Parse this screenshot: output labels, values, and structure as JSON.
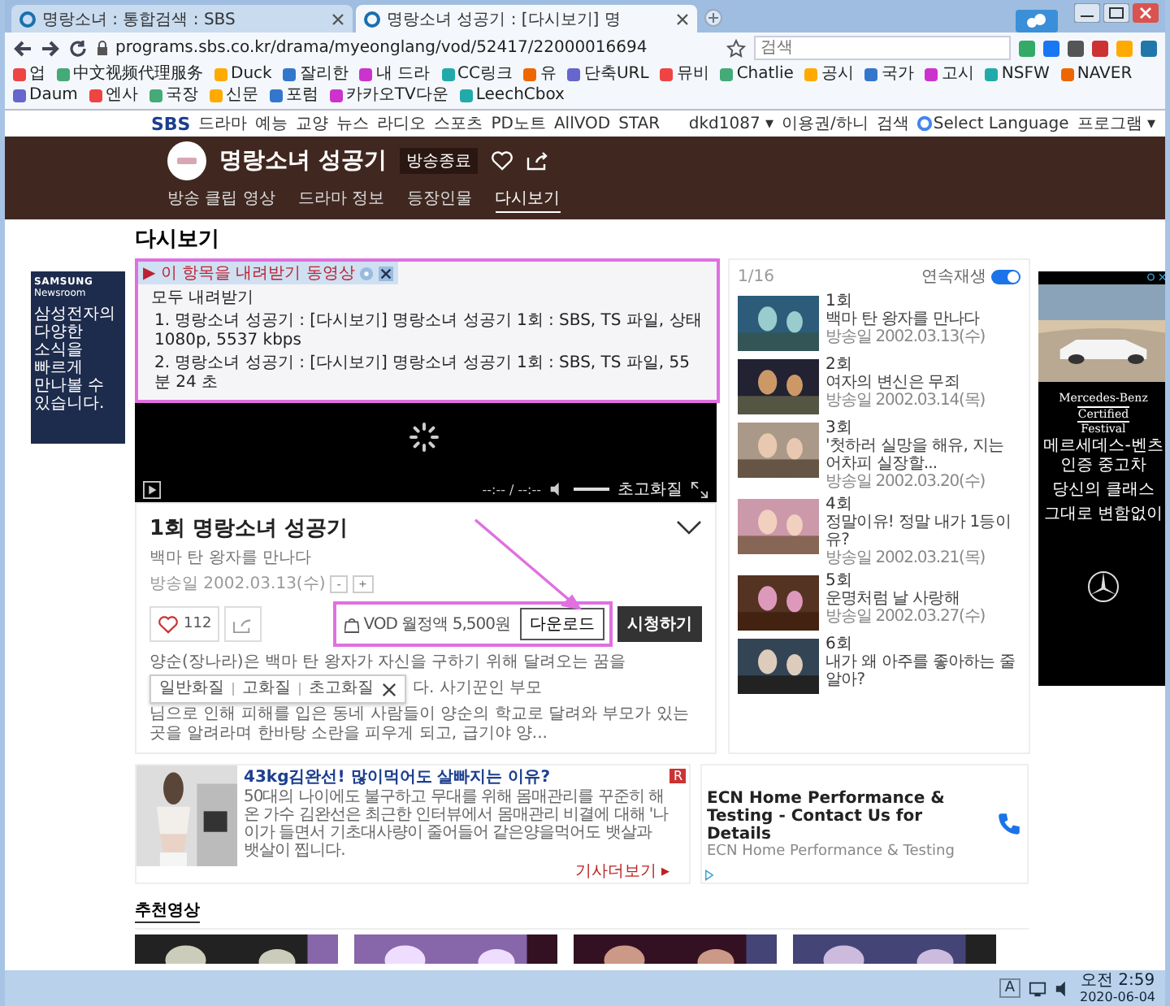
{
  "browser": {
    "tabs": [
      {
        "label": "명랑소녀 : 통합검색 : SBS",
        "selected": false
      },
      {
        "label": "명랑소녀 성공기 : [다시보기] 명",
        "selected": true
      }
    ],
    "url": "programs.sbs.co.kr/drama/myeonglang/vod/52417/22000016694",
    "search": {
      "placeholder": "검색"
    },
    "bookmarks": [
      "업",
      "中文视频代理服务",
      "Duck",
      "잘리한",
      "내 드라",
      "CC링크",
      "유",
      "단축URL",
      "뮤비",
      "Chatlie",
      "공시",
      "국가",
      "고시",
      "NSFW",
      "NAVER",
      "Daum",
      "엔사",
      "국장",
      "신문",
      "포럼",
      "카카오TV다운",
      "LeechCbox"
    ]
  },
  "site_nav": {
    "logo": "SBS",
    "items": [
      "드라마",
      "예능",
      "교양",
      "뉴스",
      "라디오",
      "스포츠",
      "PD노트",
      "AllVOD",
      "STAR"
    ],
    "user": "dkd1087 ▾",
    "links": [
      "이용권/하니",
      "검색"
    ],
    "language": "Select Language",
    "programs": "프로그램 ▾"
  },
  "show_header": {
    "title": "명랑소녀 성공기",
    "badge": "방송종료",
    "tabs": [
      {
        "label": "방송 클립 영상",
        "selected": false
      },
      {
        "label": "드라마 정보",
        "selected": false
      },
      {
        "label": "등장인물",
        "selected": false
      },
      {
        "label": "다시보기",
        "selected": true
      }
    ]
  },
  "page_title": "다시보기",
  "left_ad": {
    "brand": "SAMSUNG",
    "sub": "Newsroom",
    "lines": [
      "삼성전자의",
      "다양한",
      "소식을",
      "빠르게",
      "만나볼 수",
      "있습니다."
    ]
  },
  "player": {
    "time": "--:-- / --:--",
    "volume": {
      "level": 1
    },
    "quality": "초고화질"
  },
  "download_popup": {
    "title": "▶ 이 항목을 내려받기 동영상",
    "all": "모두 내려받기",
    "items": [
      "1. 명랑소녀 성공기 : [다시보기] 명랑소녀 성공기 1회 : SBS, TS 파일, 상태 1080p, 5537 kbps",
      "2. 명랑소녀 성공기 : [다시보기] 명랑소녀 성공기 1회 : SBS, TS 파일, 55 분 24 초"
    ]
  },
  "episode": {
    "title": "1회 명랑소녀 성공기",
    "subtitle": "백마 탄 왕자를 만나다",
    "date": "방송일 2002.03.13(수)",
    "size_buttons": [
      "-",
      "+"
    ],
    "likes": "112",
    "vod_price": "VOD 월정액 5,500원",
    "download": "다운로드",
    "watch": "시청하기",
    "qualities": [
      "일반화질",
      "고화질",
      "초고화질"
    ],
    "description": [
      "양순(장나라)은 백마 탄 왕자가 자신을 구하기 위해 달려오는 꿈을",
      "다. 사기꾼인 부모",
      "님으로 인해 피해를 입은 동네 사람들이 양순의 학교로 달려와 부모가 있는 곳을 알려라며 한바탕 소란을 피우게 되고, 급기야 양..."
    ]
  },
  "playlist": {
    "count": "1/16",
    "autoplay": {
      "label": "연속재생",
      "on": true
    },
    "items": [
      {
        "episode": "1회",
        "title": "백마 탄 왕자를 만나다",
        "date": "방송일 2002.03.13(수)"
      },
      {
        "episode": "2회",
        "title": "여자의 변신은 무죄",
        "date": "방송일 2002.03.14(목)"
      },
      {
        "episode": "3회",
        "title": "'첫하러 실망을 해유, 지는 어차피 실장할...",
        "date": "방송일 2002.03.20(수)"
      },
      {
        "episode": "4회",
        "title": "정말이유! 정말 내가 1등이유?",
        "date": "방송일 2002.03.21(목)"
      },
      {
        "episode": "5회",
        "title": "운명처럼 날 사랑해",
        "date": "방송일 2002.03.27(수)"
      },
      {
        "episode": "6회",
        "title": "내가 왜 아주를 좋아하는 줄 알아?"
      }
    ]
  },
  "right_ad": {
    "brand": [
      "Mercedes-Benz",
      "Certified",
      "Festival"
    ],
    "lines": [
      "메르세데스-벤츠",
      "인증 중고차"
    ],
    "tagline": [
      "당신의 클래스",
      "그대로 변함없이"
    ]
  },
  "ads": [
    {
      "kind": "article",
      "title": "43kg김완선! 많이먹어도 살빠지는 이유?",
      "text": "50대의 나이에도 불구하고 무대를 위해 몸매관리를 꾸준히 해온 가수 김완선은 최근한 인터뷰에서 몸매관리 비결에 대해 '나이가 들면서 기초대사량이 줄어들어 같은양을먹어도 뱃살과 뱃살이 찝니다.",
      "more": "기사더보기 ▸",
      "badge": "R"
    },
    {
      "kind": "contact",
      "title": "ECN Home Performance & Testing - Contact Us for Details",
      "text": "ECN Home Performance & Testing"
    }
  ],
  "recommended": {
    "title": "추천영상"
  },
  "taskbar": {
    "ime": "A",
    "time": "오전 2:59",
    "date": "2020-06-04"
  }
}
